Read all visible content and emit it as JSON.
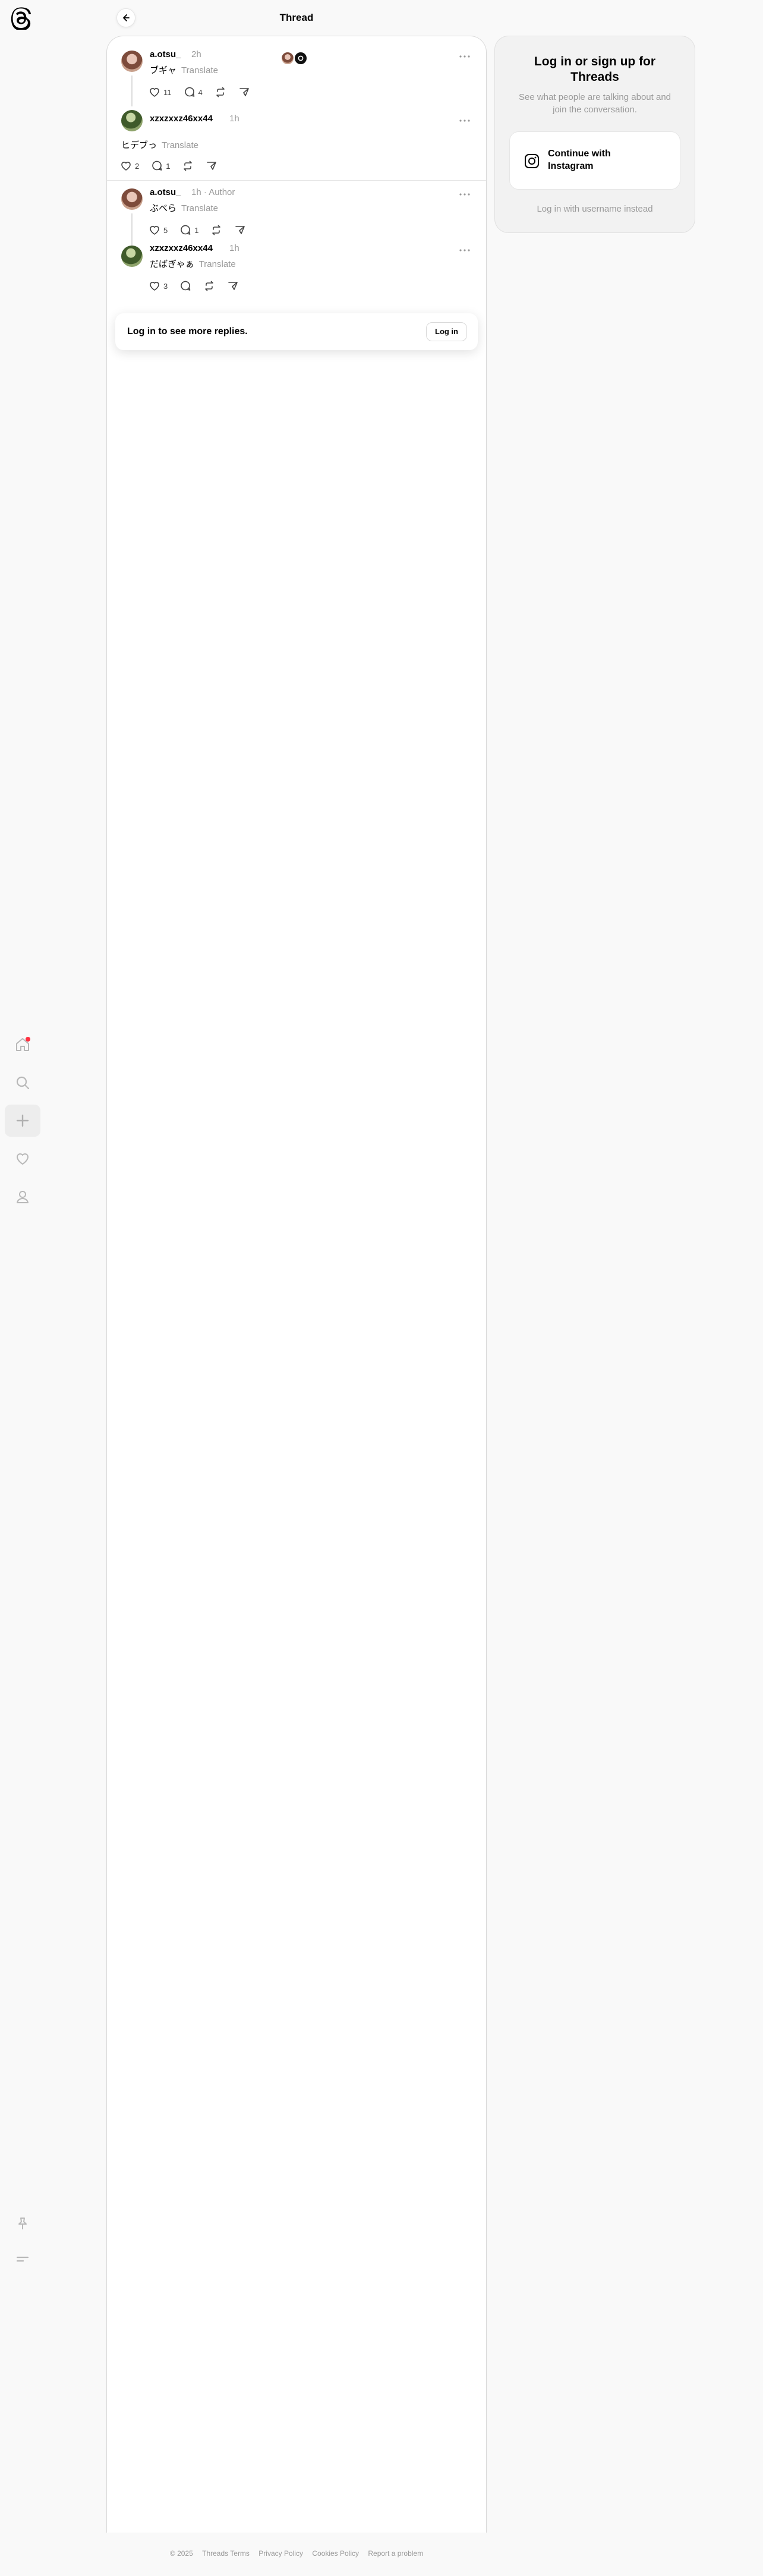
{
  "header": {
    "title": "Thread"
  },
  "posts": [
    {
      "username": "a.otsu_",
      "time": "2h",
      "text": "ブギャ",
      "translate": "Translate",
      "likes": "11",
      "replies": "4"
    },
    {
      "username": "xzxzxxz46xx44",
      "time": "1h",
      "text": "ヒデブっ",
      "translate": "Translate",
      "likes": "2",
      "replies": "1"
    },
    {
      "username": "a.otsu_",
      "time": "1h",
      "author_tag": "· Author",
      "text": "ぶべら",
      "translate": "Translate",
      "likes": "5",
      "replies": "1"
    },
    {
      "username": "xzxzxxz46xx44",
      "time": "1h",
      "text": "だばぎゃぁ",
      "translate": "Translate",
      "likes": "3",
      "replies": ""
    }
  ],
  "login_bar": {
    "text": "Log in to see more replies.",
    "button": "Log in"
  },
  "right_panel": {
    "title": "Log in or sign up for Threads",
    "subtitle": "See what people are talking about and join the conversation.",
    "instagram_button": "Continue with Instagram",
    "alt_login": "Log in with username instead"
  },
  "footer": {
    "copyright": "© 2025",
    "links": [
      "Threads Terms",
      "Privacy Policy",
      "Cookies Policy",
      "Report a problem"
    ]
  },
  "colors": {
    "notification_dot": "#ff3040",
    "muted_text": "#999999"
  }
}
